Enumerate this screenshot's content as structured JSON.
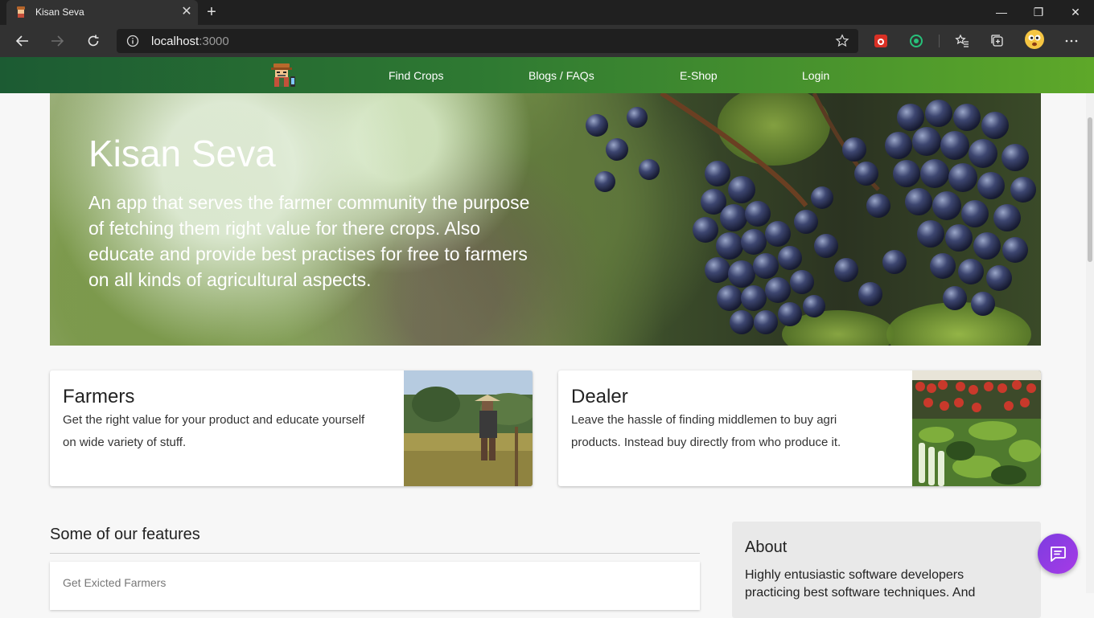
{
  "browser": {
    "tab_title": "Kisan Seva",
    "tab_close": "✕",
    "new_tab": "+",
    "url_host": "localhost",
    "url_port": ":3000",
    "window_controls": {
      "minimize": "—",
      "restore": "❐",
      "close": "✕"
    },
    "icons": [
      "back-icon",
      "forward-icon",
      "refresh-icon",
      "info-icon",
      "favorite-star-icon",
      "extension-icon",
      "extension-icon",
      "favorites-icon",
      "collections-icon",
      "profile-avatar-icon",
      "more-menu-icon"
    ]
  },
  "nav": {
    "items": [
      {
        "label": "Find Crops"
      },
      {
        "label": "Blogs / FAQs"
      },
      {
        "label": "E-Shop"
      },
      {
        "label": "Login"
      }
    ]
  },
  "hero": {
    "title": "Kisan Seva",
    "description": "An app that serves the farmer community the purpose of fetching them right value for there crops. Also educate and provide best practises for free to farmers on all kinds of agricultural aspects."
  },
  "cards": [
    {
      "title": "Farmers",
      "text": "Get the right value for your product and educate yourself on wide variety of stuff."
    },
    {
      "title": "Dealer",
      "text": "Leave the hassle of finding middlemen to buy agri products. Instead buy directly from who produce it."
    }
  ],
  "features": {
    "heading": "Some of our features",
    "items": [
      {
        "label": "Get Exicted Farmers"
      }
    ]
  },
  "about": {
    "title": "About",
    "text": "Highly entusiastic software developers practicing best software techniques. And"
  },
  "colors": {
    "nav_start": "#1c5b33",
    "nav_end": "#5ea829",
    "chat_fab": "#8e3be3"
  }
}
